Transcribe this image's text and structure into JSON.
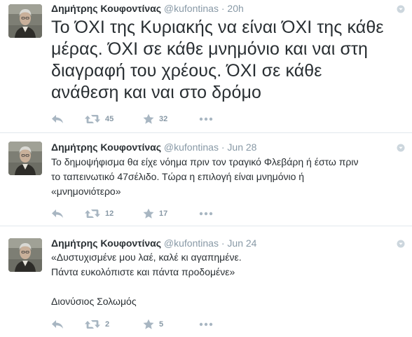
{
  "tweets": [
    {
      "name": "Δημήτρης Κουφοντίνας",
      "handle": "@kufontinas",
      "separator": "·",
      "time": "20h",
      "lines": [
        "Το ΌΧΙ της Κυριακής να είναι ΌΧΙ της κάθε",
        "μέρας. ΌΧΙ σε κάθε μνημόνιο και ναι στη",
        "διαγραφή του χρέους. ΌΧΙ σε κάθε",
        "ανάθεση και ναι στο δρόμο"
      ],
      "retweets": "45",
      "favorites": "32"
    },
    {
      "name": "Δημήτρης Κουφοντίνας",
      "handle": "@kufontinas",
      "separator": "·",
      "time": "Jun 28",
      "lines": [
        "Το δημοψήφισμα θα είχε νόημα πριν τον τραγικό Φλεβάρη ή έστω πριν",
        "το ταπεινωτικό 47σέλιδο. Τώρα η επιλογή είναι μνημόνιο ή",
        "«μνημονιότερο»"
      ],
      "retweets": "12",
      "favorites": "17"
    },
    {
      "name": "Δημήτρης Κουφοντίνας",
      "handle": "@kufontinas",
      "separator": "·",
      "time": "Jun 24",
      "lines": [
        "«Δυστυχισμένε μου λαέ, καλέ κι αγαπημένε.",
        "Πάντα ευκολόπιστε και πάντα προδομένε»",
        "",
        "Διονύσιος Σολωμός"
      ],
      "retweets": "2",
      "favorites": "5"
    }
  ]
}
